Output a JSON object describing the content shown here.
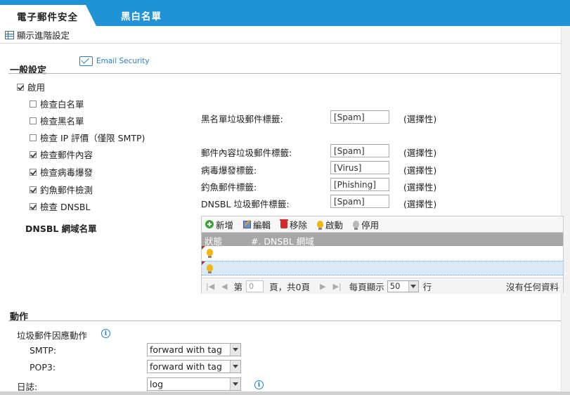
{
  "tabs": [
    {
      "label": "電子郵件安全",
      "active": true
    },
    {
      "label": "黑白名單",
      "active": false
    }
  ],
  "advanced_link": "顯示進階設定",
  "general": {
    "title": "一般設定",
    "logo_text": "Email Security",
    "enable_label": "啟用",
    "enable_checked": true,
    "options": [
      {
        "label": "檢查白名單",
        "checked": false
      },
      {
        "label": "檢查黑名單",
        "checked": false
      },
      {
        "label": "檢查 IP 評價（僅限 SMTP)",
        "checked": false
      },
      {
        "label": "檢查郵件內容",
        "checked": true
      },
      {
        "label": "檢查病毒爆發",
        "checked": true
      },
      {
        "label": "釣魚郵件檢測",
        "checked": true
      },
      {
        "label": "檢查 DNSBL",
        "checked": true
      }
    ],
    "dnsbl_list_label": "DNSBL 網域名單"
  },
  "tags": [
    {
      "label": "黑名單垃圾郵件標籤:",
      "value": "[Spam]",
      "optional": "(選擇性)"
    },
    {
      "label": "郵件內容垃圾郵件標籤:",
      "value": "[Spam]",
      "optional": "(選擇性)"
    },
    {
      "label": "病毒爆發標籤:",
      "value": "[Virus]",
      "optional": "(選擇性)"
    },
    {
      "label": "釣魚郵件標籤:",
      "value": "[Phishing]",
      "optional": "(選擇性)"
    },
    {
      "label": "DNSBL 垃圾郵件標籤:",
      "value": "[Spam]",
      "optional": "(選擇性)"
    }
  ],
  "table": {
    "toolbar": {
      "add": "新增",
      "edit": "編輯",
      "remove": "移除",
      "activate": "啟動",
      "deactivate": "停用"
    },
    "columns": [
      "狀態",
      "#. DNSBL 網域"
    ],
    "rows": [
      {
        "status": "on",
        "domain": ""
      },
      {
        "status": "on",
        "domain": ""
      }
    ],
    "pager": {
      "page_prefix": "第",
      "page_value": "0",
      "page_suffix": "頁，共0頁",
      "per_page_label": "每頁顯示",
      "per_page_value": "50",
      "per_page_unit": "行",
      "empty_text": "沒有任何資料"
    }
  },
  "action": {
    "title": "動作",
    "spam_action_label": "垃圾郵件因應動作",
    "smtp_label": "SMTP:",
    "smtp_value": "forward with tag",
    "pop3_label": "POP3:",
    "pop3_value": "forward with tag",
    "log_label": "日誌:",
    "log_value": "log"
  },
  "colors": {
    "accent": "#1f93d6",
    "table_header": "#a7a7a7",
    "selected_row": "#d9e9f7"
  }
}
